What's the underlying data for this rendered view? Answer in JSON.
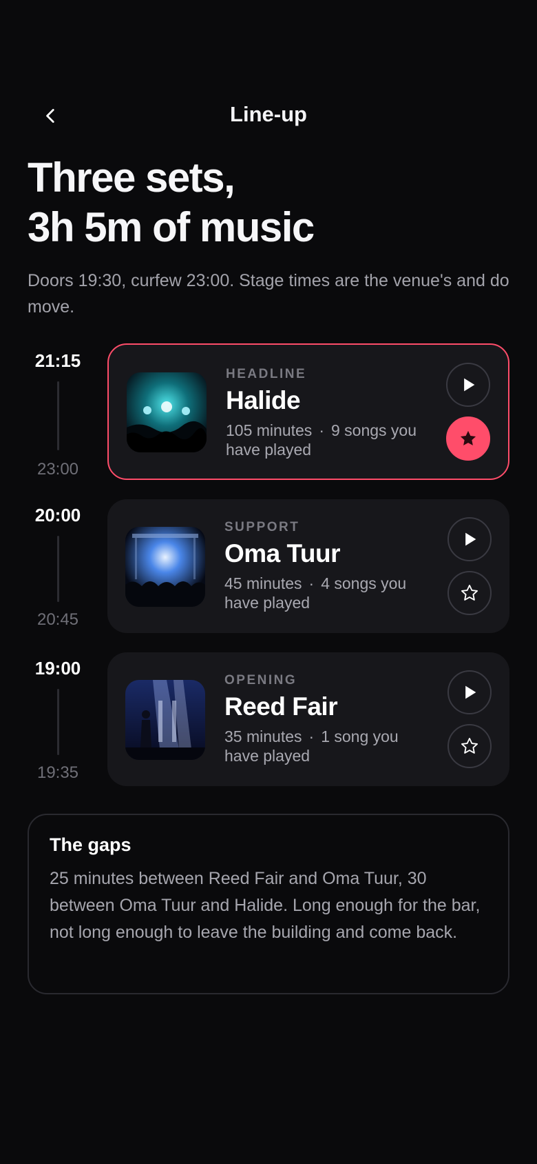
{
  "header": {
    "title": "Line-up",
    "back_icon": "chevron-left-icon"
  },
  "hero": {
    "title_line1": "Three sets,",
    "title_line2": "3h 5m of music",
    "subtitle": "Doors 19:30, curfew 23:00. Stage times are the venue's and do move."
  },
  "sets": [
    {
      "start": "21:15",
      "end": "23:00",
      "role": "HEADLINE",
      "name": "Halide",
      "duration": "105 minutes",
      "separator": "·",
      "played_line1": "9 songs you",
      "played_line2": "have played",
      "favorited": true
    },
    {
      "start": "20:00",
      "end": "20:45",
      "role": "SUPPORT",
      "name": "Oma Tuur",
      "duration": "45 minutes",
      "separator": "·",
      "played_line1": "4 songs you",
      "played_line2": "have played",
      "favorited": false
    },
    {
      "start": "19:00",
      "end": "19:35",
      "role": "OPENING",
      "name": "Reed Fair",
      "duration": "35 minutes",
      "separator": "·",
      "played_line1": "1 song you",
      "played_line2": "have played",
      "favorited": false
    }
  ],
  "gaps": {
    "title": "The gaps",
    "body": "25 minutes between Reed Fair and Oma Tuur, 30 between Oma Tuur and Halide. Long enough for the bar, not long enough to leave the building and come back."
  },
  "colors": {
    "background": "#0a0a0c",
    "card": "#17171b",
    "accent": "#ff4d6a",
    "muted_text": "#a6a6ae"
  }
}
